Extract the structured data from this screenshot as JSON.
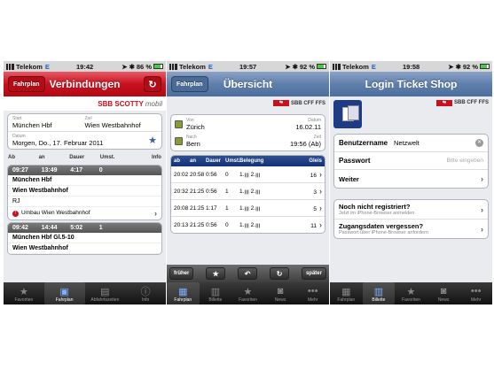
{
  "screens": [
    {
      "status": {
        "carrier": "Telekom",
        "net": "E",
        "time": "19:42",
        "battery": "86 %"
      },
      "nav": {
        "back": "Fahrplan",
        "title": "Verbindungen",
        "refresh": "↻"
      },
      "brand": {
        "logo": "SBB",
        "name": "SCOTTY",
        "suffix": "mobil"
      },
      "form": {
        "start_label": "Start",
        "start": "München Hbf",
        "ziel_label": "Ziel",
        "ziel": "Wien Westbahnhof",
        "datum_label": "Datum",
        "datum": "Morgen, Do., 17. Februar 2011"
      },
      "headers": [
        "Ab",
        "an",
        "Dauer",
        "Umst.",
        "Info"
      ],
      "connections": [
        {
          "ab": "09:27",
          "an": "13:49",
          "dauer": "4:17",
          "umst": "0",
          "from": "München Hbf",
          "to": "Wien Westbahnhof",
          "train": "RJ",
          "warn": "Umbau Wien Westbahnhof"
        },
        {
          "ab": "09:42",
          "an": "14:44",
          "dauer": "5:02",
          "umst": "1",
          "from": "München Hbf Gl.5-10",
          "to": "Wien Westbahnhof"
        }
      ],
      "tabs": [
        "Favoriten",
        "Fahrplan",
        "Abfahrtszeiten",
        "Info"
      ]
    },
    {
      "status": {
        "carrier": "Telekom",
        "net": "E",
        "time": "19:57",
        "battery": "92 %"
      },
      "nav": {
        "back": "Fahrplan",
        "title": "Übersicht"
      },
      "sbb": "SBB CFF FFS",
      "route": {
        "von_label": "Von",
        "von": "Zürich",
        "datum_label": "Datum",
        "datum": "16.02.11",
        "nach_label": "Nach",
        "nach": "Bern",
        "zeit_label": "Zeit",
        "zeit": "19:56 (Ab)"
      },
      "headers": [
        "ab",
        "an",
        "Dauer",
        "Umst.",
        "Belegung",
        "Gleis"
      ],
      "rows": [
        {
          "ab": "20:02",
          "an": "20:58",
          "dauer": "0:56",
          "umst": "0",
          "bel": "1.ꞁꞁꞁ 2.ꞁꞁꞁ",
          "gleis": "16"
        },
        {
          "ab": "20:32",
          "an": "21:25",
          "dauer": "0:56",
          "umst": "1",
          "bel": "1.ꞁꞁꞁ 2.ꞁꞁꞁ",
          "gleis": "3"
        },
        {
          "ab": "20:08",
          "an": "21:25",
          "dauer": "1:17",
          "umst": "1",
          "bel": "1.ꞁꞁꞁ 2.ꞁꞁꞁ",
          "gleis": "5"
        },
        {
          "ab": "20:13",
          "an": "21:25",
          "dauer": "0:56",
          "umst": "0",
          "bel": "1.ꞁꞁꞁ 2.ꞁꞁꞁ",
          "gleis": "11"
        }
      ],
      "toolbar": {
        "earlier": "früher",
        "later": "später"
      },
      "tabs": [
        "Fahrplan",
        "Billette",
        "Favoriten",
        "News",
        "Mehr"
      ]
    },
    {
      "status": {
        "carrier": "Telekom",
        "net": "E",
        "time": "19:58",
        "battery": "92 %"
      },
      "nav": {
        "title": "Login Ticket Shop"
      },
      "sbb": "SBB CFF FFS",
      "form": {
        "user_label": "Benutzername",
        "user": "Netzwelt",
        "pass_label": "Passwort",
        "pass_ph": "Bitte eingeben",
        "next": "Weiter"
      },
      "help": [
        {
          "title": "Noch nicht registriert?",
          "sub": "Jetzt im iPhone-Browser anmelden"
        },
        {
          "title": "Zugangsdaten vergessen?",
          "sub": "Passwort über iPhone-Browser anfordern"
        }
      ],
      "tabs": [
        "Fahrplan",
        "Billette",
        "Favoriten",
        "News",
        "Mehr"
      ]
    }
  ]
}
